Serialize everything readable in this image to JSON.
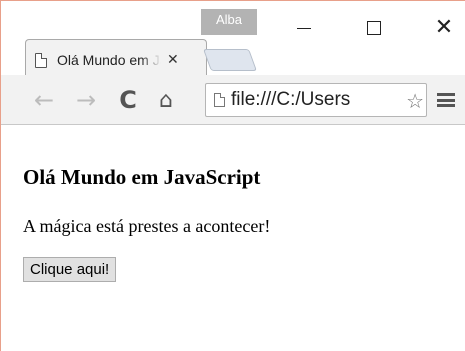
{
  "window": {
    "profile_name": "Alba",
    "minimize_symbol": "",
    "close_symbol": "✕"
  },
  "tab": {
    "title": "Olá Mundo em JavaScript",
    "close_symbol": "✕"
  },
  "toolbar": {
    "back_symbol": "←",
    "forward_symbol": "→",
    "reload_symbol": "C",
    "home_symbol": "⌂",
    "url": "file:///C:/Users",
    "star_symbol": "☆"
  },
  "page": {
    "heading": "Olá Mundo em JavaScript",
    "paragraph": "A mágica está prestes a acontecer!",
    "button_label": "Clique aqui!"
  },
  "colors": {
    "accent": "#8bc34a",
    "profile_badge": "#b3b3b3",
    "window_border": "#e8a08a"
  }
}
